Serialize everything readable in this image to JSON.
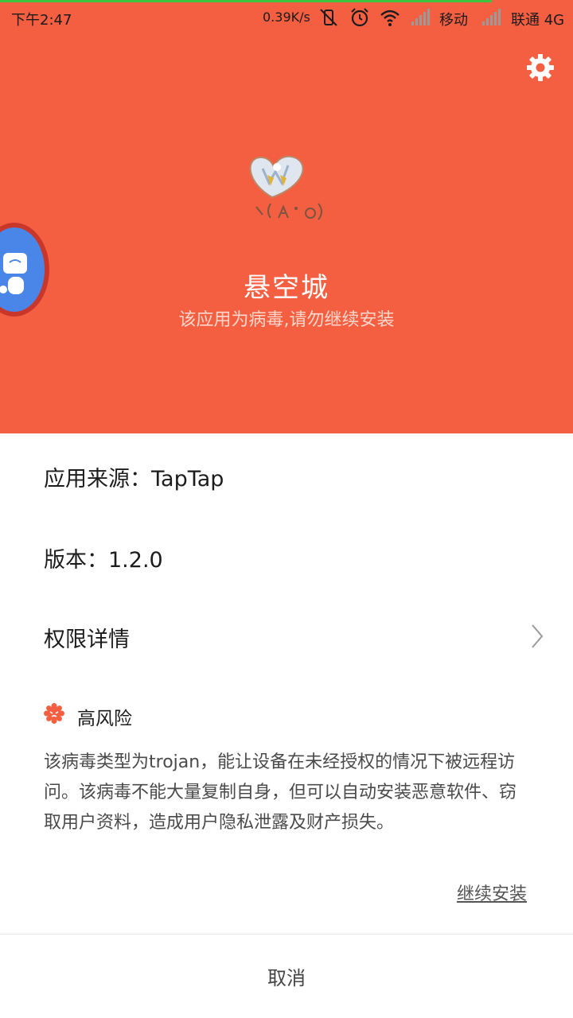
{
  "status_bar": {
    "time": "下午2:47",
    "speed": "0.39K/s",
    "carrier1": "移动",
    "carrier2": "联通 4G"
  },
  "header": {
    "app_name": "悬空城",
    "warning": "该应用为病毒,请勿继续安装",
    "bg_color": "#f55f41"
  },
  "info": {
    "source": "应用来源：TapTap",
    "version": "版本：1.2.0",
    "permissions": "权限详情"
  },
  "risk": {
    "label": "高风险",
    "color": "#f55f41",
    "description": "该病毒类型为trojan，能让设备在未经授权的情况下被远程访问。该病毒不能大量复制自身，但可以自动安装恶意软件、窃取用户资料，造成用户隐私泄露及财产损失。"
  },
  "actions": {
    "continue": "继续安装",
    "cancel": "取消"
  },
  "icons": {
    "settings": "gear-icon",
    "chevron": "chevron-right-icon",
    "risk": "warning-badge-icon"
  }
}
